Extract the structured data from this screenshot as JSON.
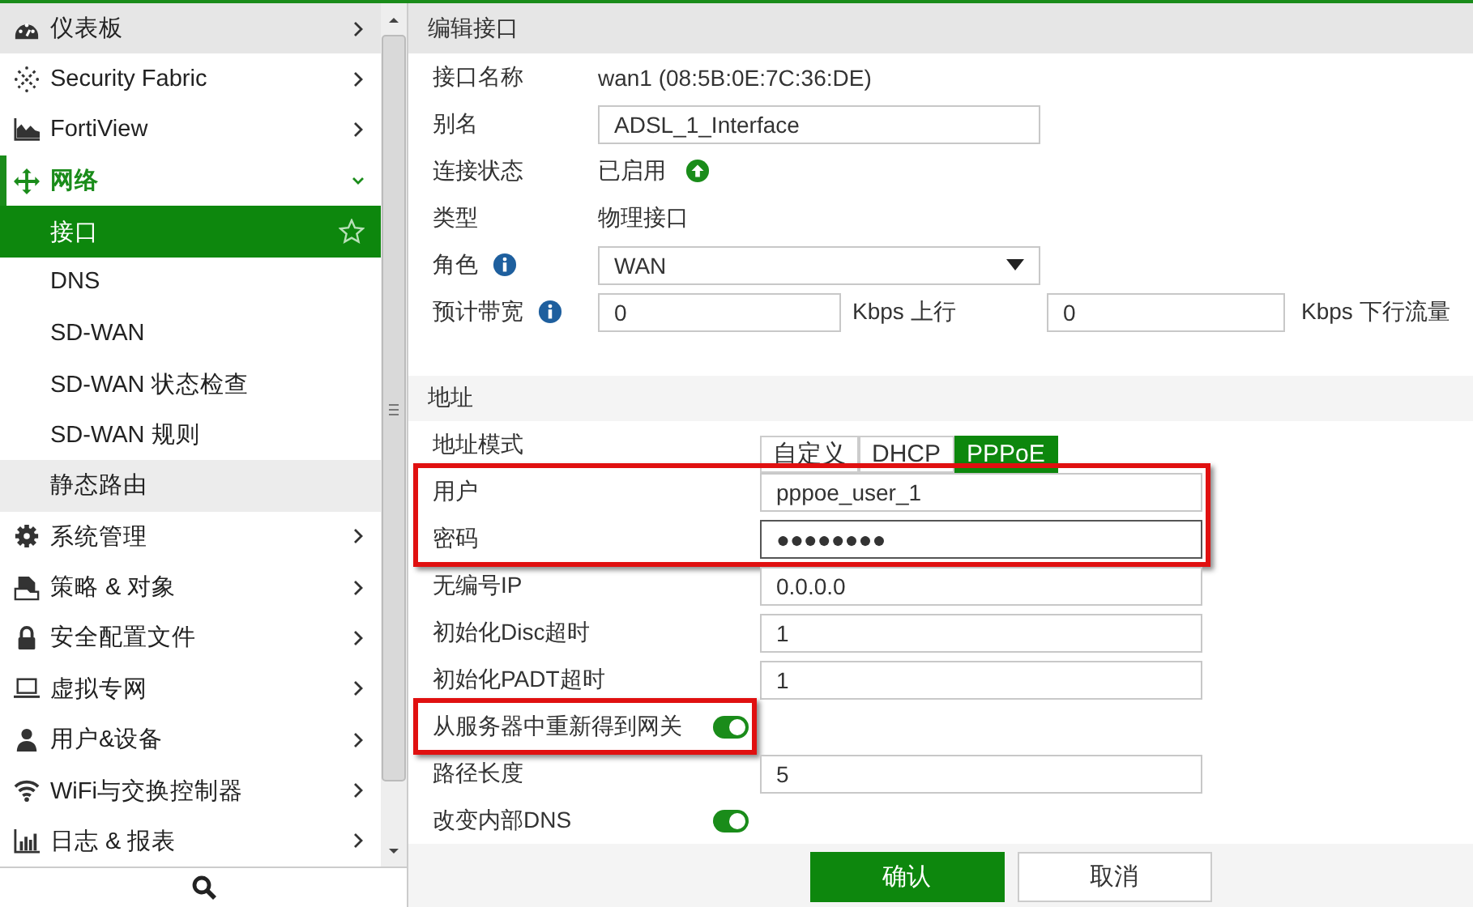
{
  "sidebar": {
    "items": [
      {
        "label": "仪表板",
        "expanded": false,
        "highlighted": true
      },
      {
        "label": "Security Fabric",
        "expanded": false,
        "highlighted": false
      },
      {
        "label": "FortiView",
        "expanded": false,
        "highlighted": false
      },
      {
        "label": "网络",
        "expanded": true,
        "highlighted": false,
        "children": [
          {
            "label": "接口",
            "selected": true,
            "highlighted": false
          },
          {
            "label": "DNS",
            "selected": false,
            "highlighted": false
          },
          {
            "label": "SD-WAN",
            "selected": false,
            "highlighted": false
          },
          {
            "label": "SD-WAN 状态检查",
            "selected": false,
            "highlighted": false
          },
          {
            "label": "SD-WAN 规则",
            "selected": false,
            "highlighted": false
          },
          {
            "label": "静态路由",
            "selected": false,
            "highlighted": true
          }
        ]
      },
      {
        "label": "系统管理",
        "expanded": false,
        "highlighted": false
      },
      {
        "label": "策略 & 对象",
        "expanded": false,
        "highlighted": false
      },
      {
        "label": "安全配置文件",
        "expanded": false,
        "highlighted": false
      },
      {
        "label": "虚拟专网",
        "expanded": false,
        "highlighted": false
      },
      {
        "label": "用户&设备",
        "expanded": false,
        "highlighted": false
      },
      {
        "label": "WiFi与交换控制器",
        "expanded": false,
        "highlighted": false
      },
      {
        "label": "日志 & 报表",
        "expanded": false,
        "highlighted": false
      }
    ]
  },
  "edit_panel": {
    "title": "编辑接口",
    "rows": [
      {
        "kind": "text",
        "label": "接口名称",
        "info": false,
        "value": "wan1 (08:5B:0E:7C:36:DE)"
      },
      {
        "kind": "input",
        "label": "别名",
        "info": false,
        "value": "ADSL_1_Interface"
      },
      {
        "kind": "status",
        "label": "连接状态",
        "info": false,
        "value": "已启用"
      },
      {
        "kind": "text",
        "label": "类型",
        "info": false,
        "value": "物理接口"
      },
      {
        "kind": "select",
        "label": "角色",
        "info": true,
        "value": "WAN"
      },
      {
        "kind": "bandwidth",
        "label": "预计带宽",
        "info": true,
        "upstream": "0",
        "upstream_unit": "Kbps 上行",
        "downstream": "0",
        "downstream_unit": "Kbps 下行流量"
      }
    ]
  },
  "address_section": {
    "title": "地址",
    "groups": [
      {
        "outlined": false,
        "rows": [
          {
            "kind": "segmented",
            "label": "地址模式",
            "options": [
              {
                "label": "自定义",
                "selected": false
              },
              {
                "label": "DHCP",
                "selected": false
              },
              {
                "label": "PPPoE",
                "selected": true
              }
            ]
          }
        ]
      },
      {
        "outlined": true,
        "rows": [
          {
            "kind": "input",
            "label": "用户",
            "value": "pppoe_user_1",
            "focused": false
          },
          {
            "kind": "input",
            "label": "密码",
            "value": "●●●●●●●●",
            "focused": true
          }
        ]
      },
      {
        "outlined": false,
        "rows": [
          {
            "kind": "input",
            "label": "无编号IP",
            "value": "0.0.0.0",
            "focused": false
          },
          {
            "kind": "input",
            "label": "初始化Disc超时",
            "value": "1",
            "focused": false
          },
          {
            "kind": "input",
            "label": "初始化PADT超时",
            "value": "1",
            "focused": false
          }
        ]
      },
      {
        "outlined": true,
        "rows": [
          {
            "kind": "toggle",
            "label": "从服务器中重新得到网关",
            "on": true
          }
        ]
      },
      {
        "outlined": false,
        "rows": [
          {
            "kind": "input",
            "label": "路径长度",
            "value": "5",
            "focused": false
          },
          {
            "kind": "toggle",
            "label": "改变内部DNS",
            "on": true
          }
        ]
      }
    ]
  },
  "footer": {
    "buttons": [
      {
        "label": "确认",
        "primary": true
      },
      {
        "label": "取消",
        "primary": false
      }
    ]
  }
}
